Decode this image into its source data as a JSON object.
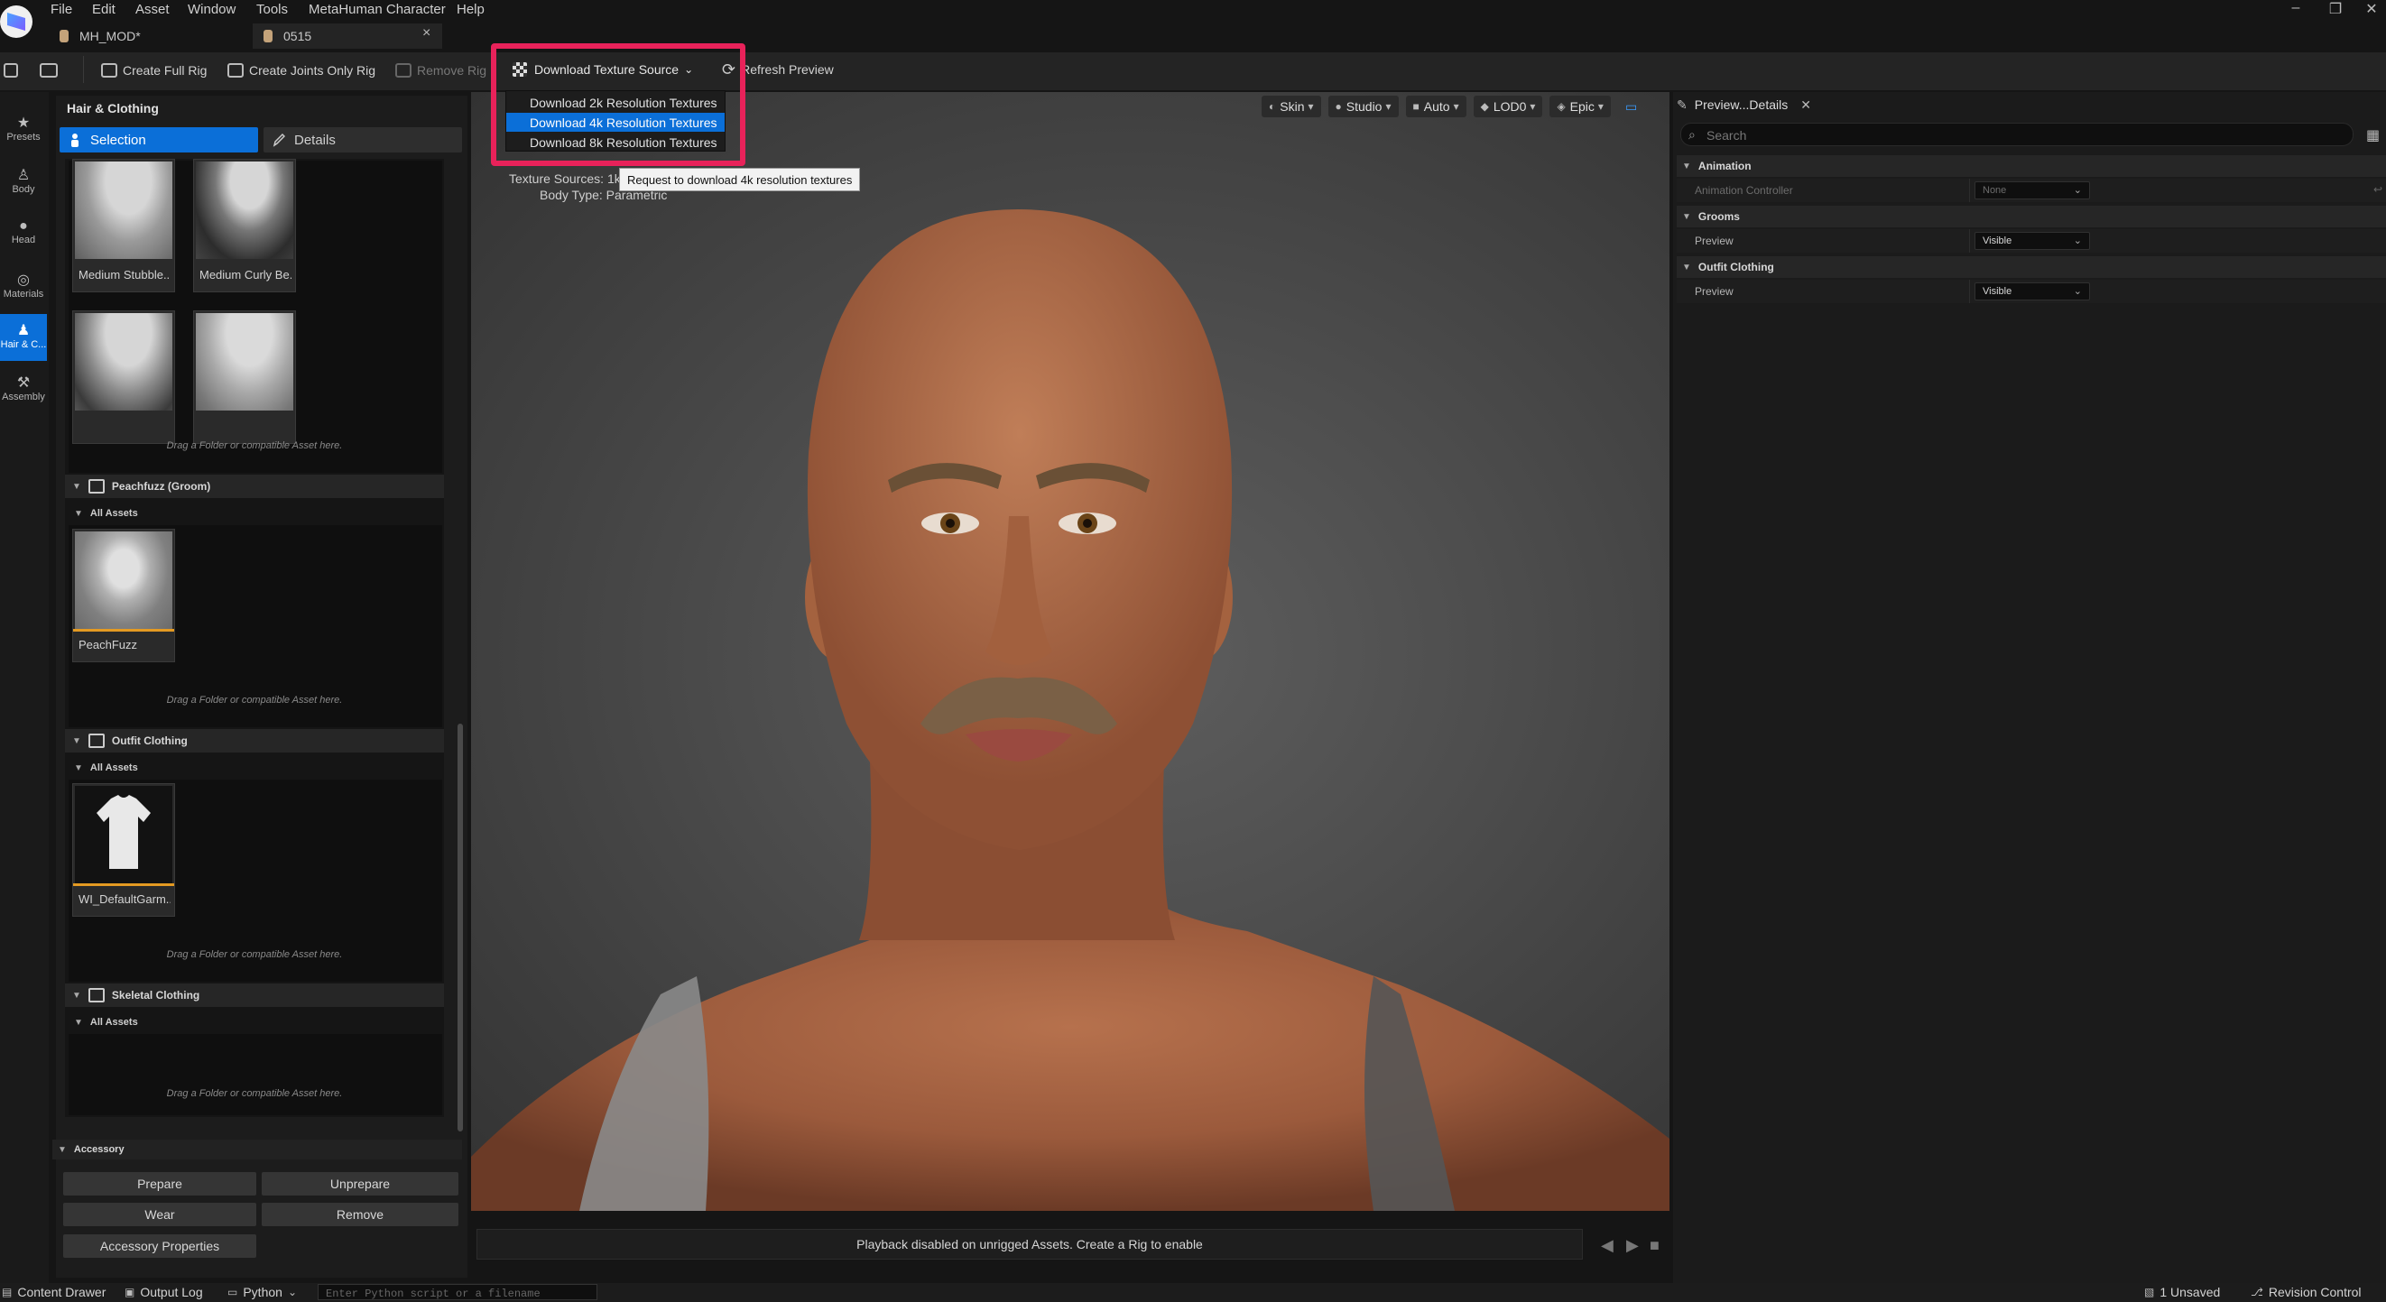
{
  "menubar": {
    "items": [
      "File",
      "Edit",
      "Asset",
      "Window",
      "Tools",
      "MetaHuman Character",
      "Help"
    ],
    "window_controls": [
      "–",
      "❐",
      "✕"
    ]
  },
  "tabs": [
    {
      "label": "MH_MOD*"
    },
    {
      "label": "0515",
      "close": "×"
    }
  ],
  "toolbar": {
    "create_full_rig": "Create Full Rig",
    "create_joints_only_rig": "Create Joints Only Rig",
    "remove_rig": "Remove Rig",
    "download_texture_source": "Download Texture Source",
    "refresh_preview": "Refresh Preview"
  },
  "download_menu": {
    "items": [
      "Download 2k Resolution Textures",
      "Download 4k Resolution Textures",
      "Download 8k Resolution Textures"
    ],
    "highlighted_index": 1,
    "tooltip": "Request to download 4k resolution textures",
    "highlight_color": "#e8225a"
  },
  "leftnav": {
    "items": [
      {
        "label": "Presets",
        "icon": "star-icon"
      },
      {
        "label": "Body",
        "icon": "body-icon"
      },
      {
        "label": "Head",
        "icon": "head-icon"
      },
      {
        "label": "Materials",
        "icon": "materials-icon"
      },
      {
        "label": "Hair & C...",
        "icon": "hair-icon"
      },
      {
        "label": "Assembly",
        "icon": "hammer-icon"
      }
    ],
    "active_index": 4
  },
  "left_panel": {
    "title": "Hair & Clothing",
    "selection_label": "Selection",
    "details_label": "Details",
    "beards": [
      "Medium Stubble...",
      "Medium Curly Be..."
    ],
    "drop_hint": "Drag a Folder or compatible Asset here.",
    "sections": [
      {
        "title": "Peachfuzz (Groom)",
        "sub": "All Assets",
        "asset": "PeachFuzz"
      },
      {
        "title": "Outfit Clothing",
        "sub": "All Assets",
        "asset": "WI_DefaultGarm..."
      },
      {
        "title": "Skeletal Clothing",
        "sub": "All Assets"
      }
    ],
    "accessory": {
      "title": "Accessory",
      "buttons": [
        "Prepare",
        "Unprepare",
        "Wear",
        "Remove",
        "Accessory Properties"
      ]
    }
  },
  "viewport": {
    "toolbar": [
      "Skin",
      "Studio",
      "Auto",
      "LOD0",
      "Epic"
    ],
    "info_line1": "Texture Sources: 1k",
    "info_line2": "Body Type: Parametric",
    "playback_message": "Playback disabled on unrigged Assets. Create a Rig to enable"
  },
  "details_panel": {
    "tab": "Preview...Details",
    "search_placeholder": "Search",
    "categories": [
      {
        "name": "Animation",
        "rows": [
          {
            "label": "Animation Controller",
            "value": "None"
          }
        ]
      },
      {
        "name": "Grooms",
        "rows": [
          {
            "label": "Preview",
            "value": "Visible"
          }
        ]
      },
      {
        "name": "Outfit Clothing",
        "rows": [
          {
            "label": "Preview",
            "value": "Visible"
          }
        ]
      }
    ]
  },
  "statusbar": {
    "content_drawer": "Content Drawer",
    "output_log": "Output Log",
    "python": "Python",
    "python_placeholder": "Enter Python script or a filename",
    "unsaved": "1 Unsaved",
    "revision_control": "Revision Control"
  },
  "colors": {
    "accent": "#0b6fd8",
    "thumbnail_bar": "#e49a22"
  }
}
